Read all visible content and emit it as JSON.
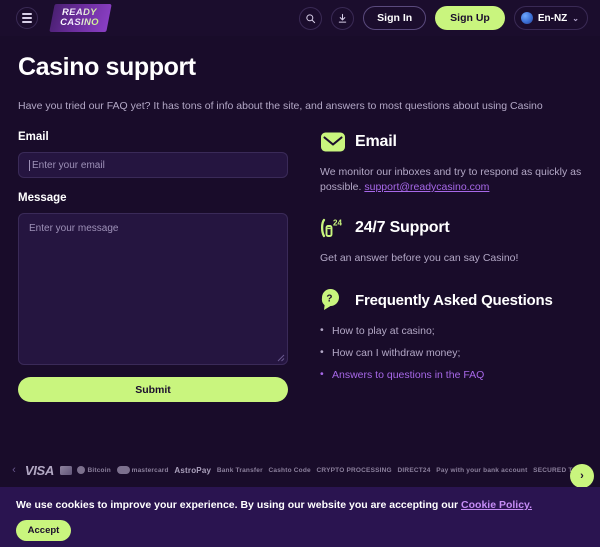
{
  "header": {
    "menu_icon": "hamburger-menu-icon",
    "logo_line1": "READY",
    "logo_line2": "CASINO",
    "search_icon": "search-icon",
    "download_icon": "download-icon",
    "sign_in_label": "Sign In",
    "sign_up_label": "Sign Up",
    "language_label": "En-NZ",
    "language_caret": "⌄"
  },
  "page": {
    "title": "Casino support",
    "intro": "Have you tried our FAQ yet? It has tons of info about the site, and answers to most questions about using Casino"
  },
  "form": {
    "email_label": "Email",
    "email_placeholder": "Enter your email",
    "email_value": "",
    "message_label": "Message",
    "message_placeholder": "Enter your message",
    "message_value": "",
    "submit_label": "Submit"
  },
  "info": {
    "email": {
      "icon": "envelope-icon",
      "title": "Email",
      "body_before": "We monitor our inboxes and try to respond as quickly as possible. ",
      "link": "support@readycasino.com"
    },
    "support": {
      "icon": "phone-24-icon",
      "title": "24/7 Support",
      "body": "Get an answer before you can say Casino!"
    },
    "faq": {
      "icon": "question-bubble-icon",
      "title": "Frequently Asked Questions",
      "items": [
        {
          "label": "How to play at casino;",
          "accent": false
        },
        {
          "label": "How can I withdraw money;",
          "accent": false
        },
        {
          "label": "Answers to questions in the FAQ",
          "accent": true
        }
      ]
    }
  },
  "payments": {
    "prev_arrow": "‹",
    "next_arrow": "›",
    "logos": [
      "VISA",
      "Card",
      "Bitcoin",
      "mastercard",
      "AstroPay",
      "Bank Transfer",
      "Cashto Code",
      "CRYPTO PROCESSING",
      "DIRECT24",
      "Pay with your bank account",
      "SECURED Trustly",
      ""
    ]
  },
  "cookie": {
    "text_before": "We use cookies to improve your experience. By using our website you are accepting our ",
    "link": "Cookie Policy.",
    "accept_label": "Accept"
  }
}
